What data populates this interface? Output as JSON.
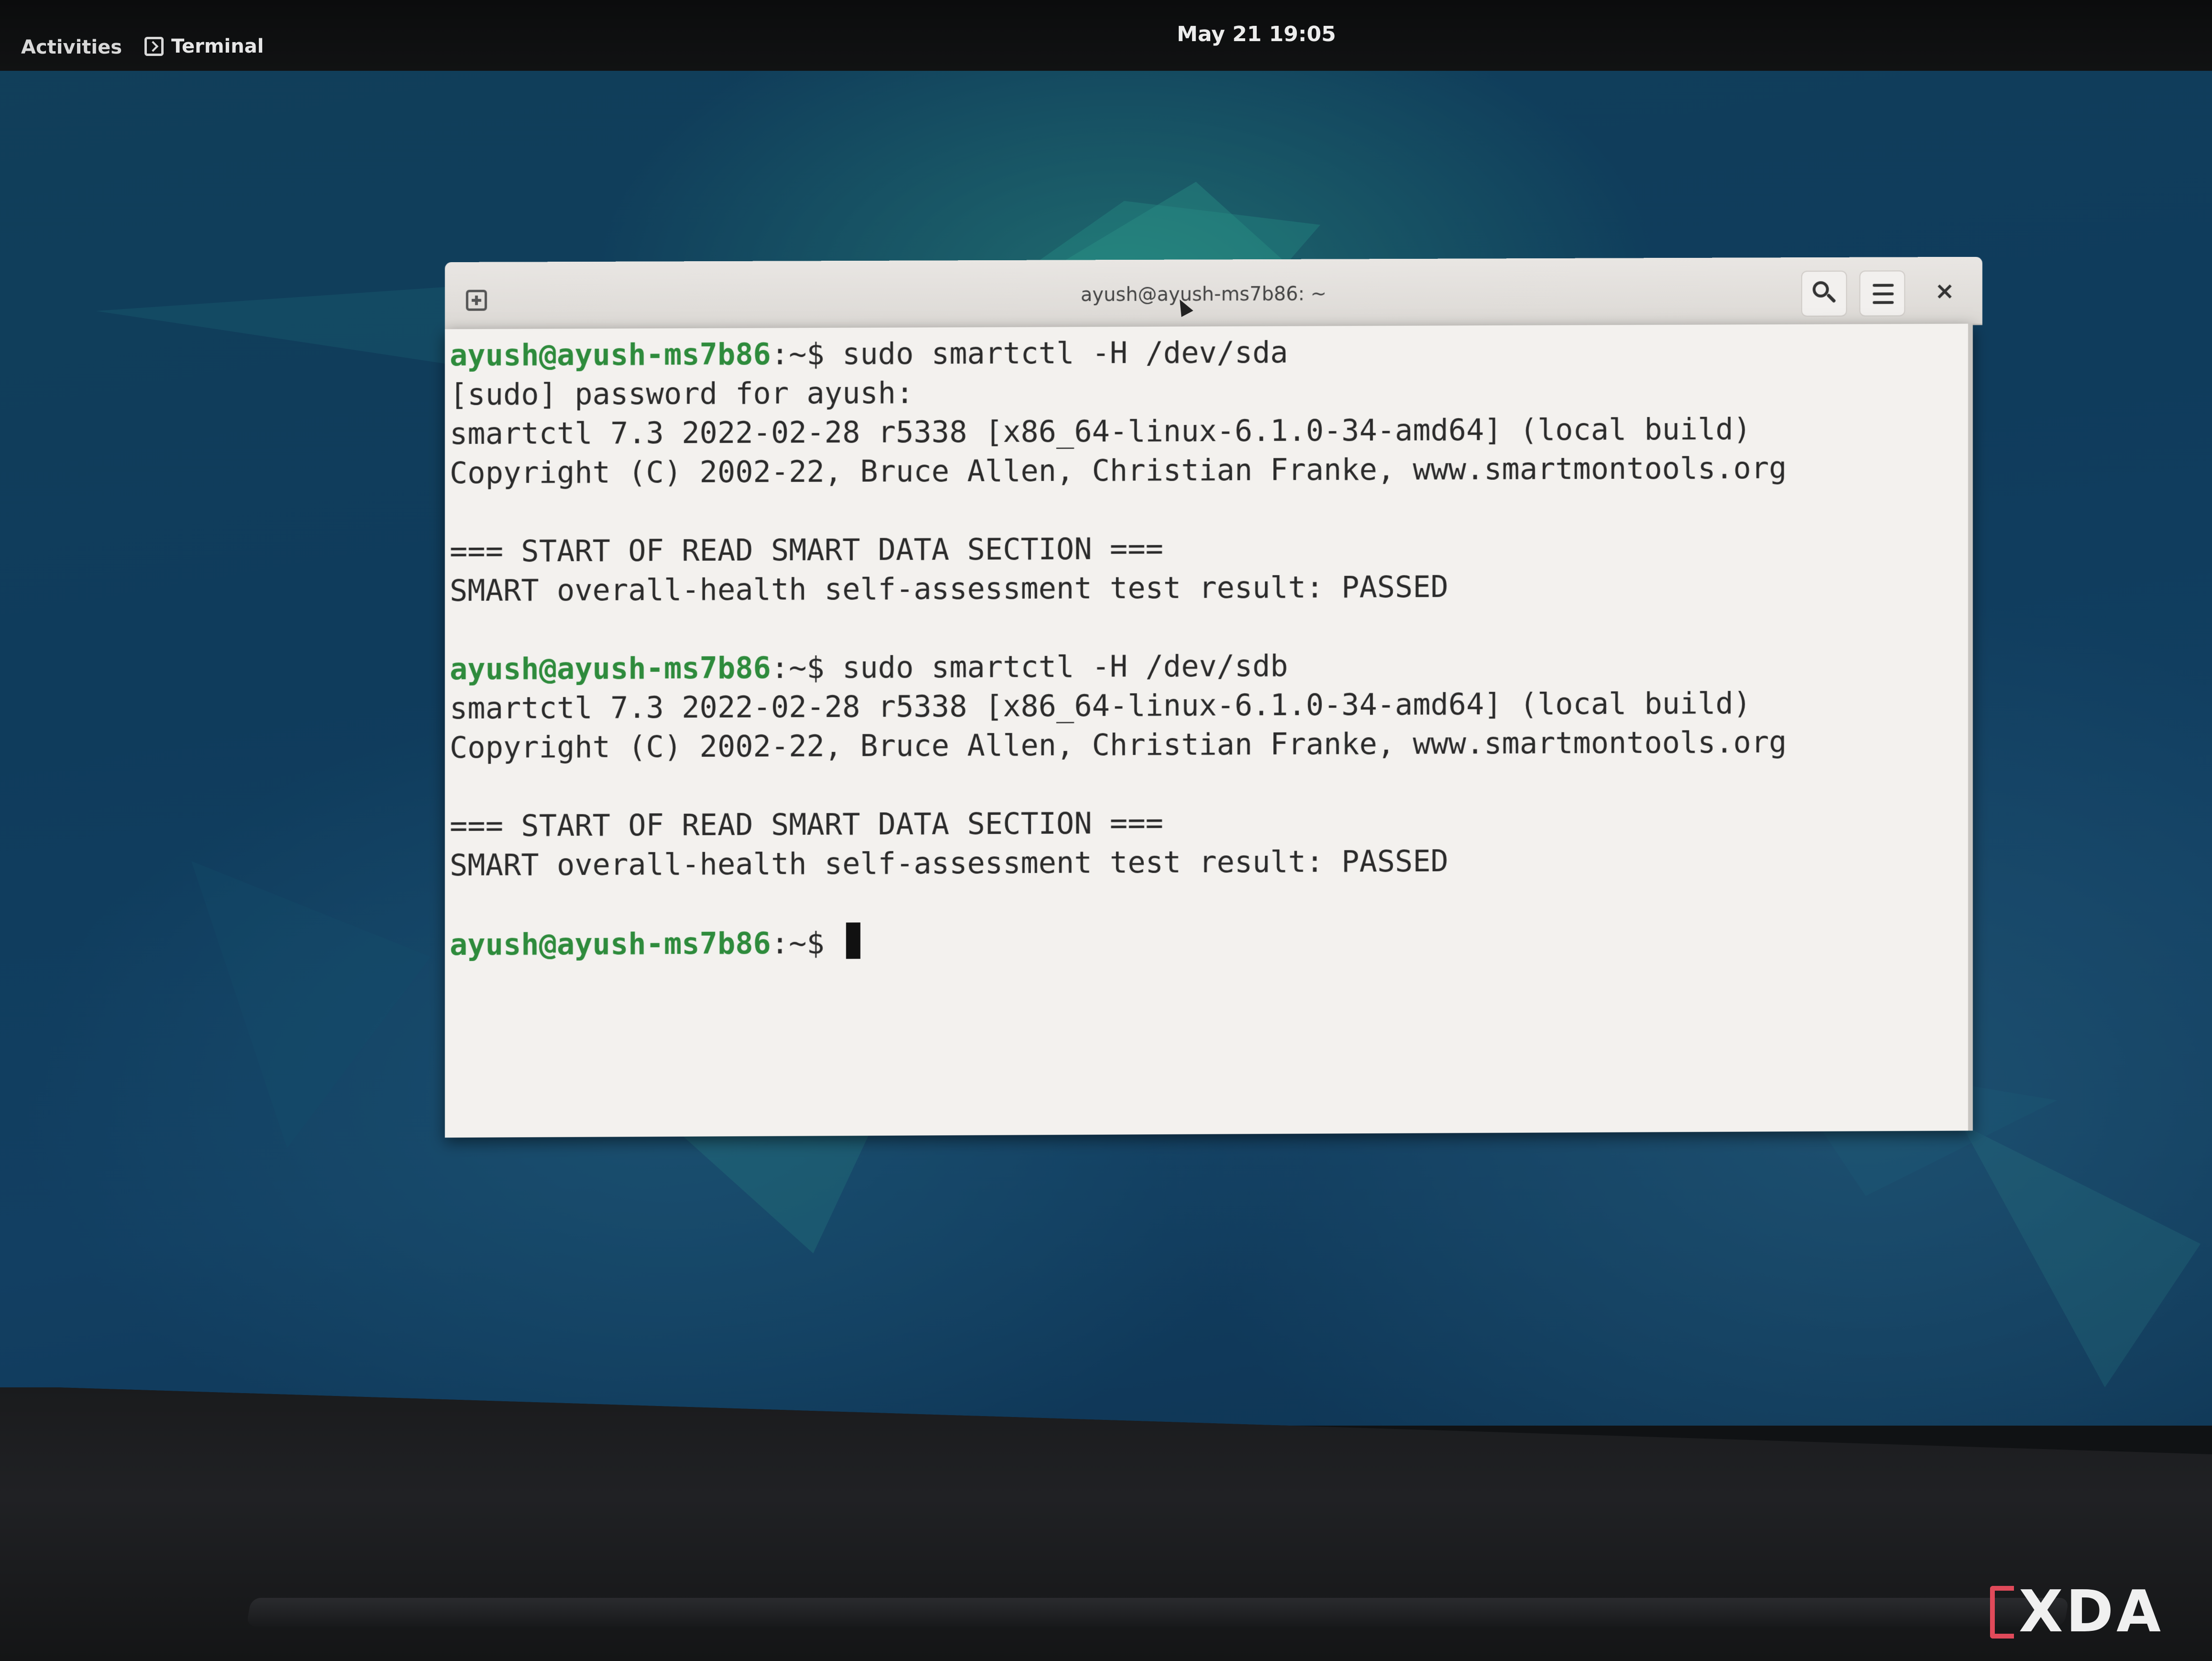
{
  "topbar": {
    "activities_label": "Activities",
    "app_label": "Terminal",
    "clock": "May 21  19:05"
  },
  "window": {
    "title": "ayush@ayush-ms7b86: ~"
  },
  "terminal": {
    "prompt": "ayush@ayush-ms7b86",
    "prompt_suffix": ":~$ ",
    "lines": [
      {
        "prompt": "ayush@ayush-ms7b86",
        "suffix": ":~$ ",
        "text": "sudo smartctl -H /dev/sda"
      },
      {
        "prompt": "",
        "suffix": "",
        "text": "[sudo] password for ayush:"
      },
      {
        "prompt": "",
        "suffix": "",
        "text": "smartctl 7.3 2022-02-28 r5338 [x86_64-linux-6.1.0-34-amd64] (local build)"
      },
      {
        "prompt": "",
        "suffix": "",
        "text": "Copyright (C) 2002-22, Bruce Allen, Christian Franke, www.smartmontools.org"
      },
      {
        "prompt": "",
        "suffix": "",
        "text": ""
      },
      {
        "prompt": "",
        "suffix": "",
        "text": "=== START OF READ SMART DATA SECTION ==="
      },
      {
        "prompt": "",
        "suffix": "",
        "text": "SMART overall-health self-assessment test result: PASSED"
      },
      {
        "prompt": "",
        "suffix": "",
        "text": ""
      },
      {
        "prompt": "ayush@ayush-ms7b86",
        "suffix": ":~$ ",
        "text": "sudo smartctl -H /dev/sdb"
      },
      {
        "prompt": "",
        "suffix": "",
        "text": "smartctl 7.3 2022-02-28 r5338 [x86_64-linux-6.1.0-34-amd64] (local build)"
      },
      {
        "prompt": "",
        "suffix": "",
        "text": "Copyright (C) 2002-22, Bruce Allen, Christian Franke, www.smartmontools.org"
      },
      {
        "prompt": "",
        "suffix": "",
        "text": ""
      },
      {
        "prompt": "",
        "suffix": "",
        "text": "=== START OF READ SMART DATA SECTION ==="
      },
      {
        "prompt": "",
        "suffix": "",
        "text": "SMART overall-health self-assessment test result: PASSED"
      },
      {
        "prompt": "",
        "suffix": "",
        "text": ""
      }
    ],
    "final_prompt": "ayush@ayush-ms7b86",
    "final_suffix": ":~$ "
  },
  "watermark": {
    "text": "XDA",
    "accent_color": "#e04a5a"
  },
  "colors": {
    "prompt_green": "#2e8b3c",
    "terminal_bg": "#f3f1ee",
    "desktop_bg": "#123f62"
  }
}
